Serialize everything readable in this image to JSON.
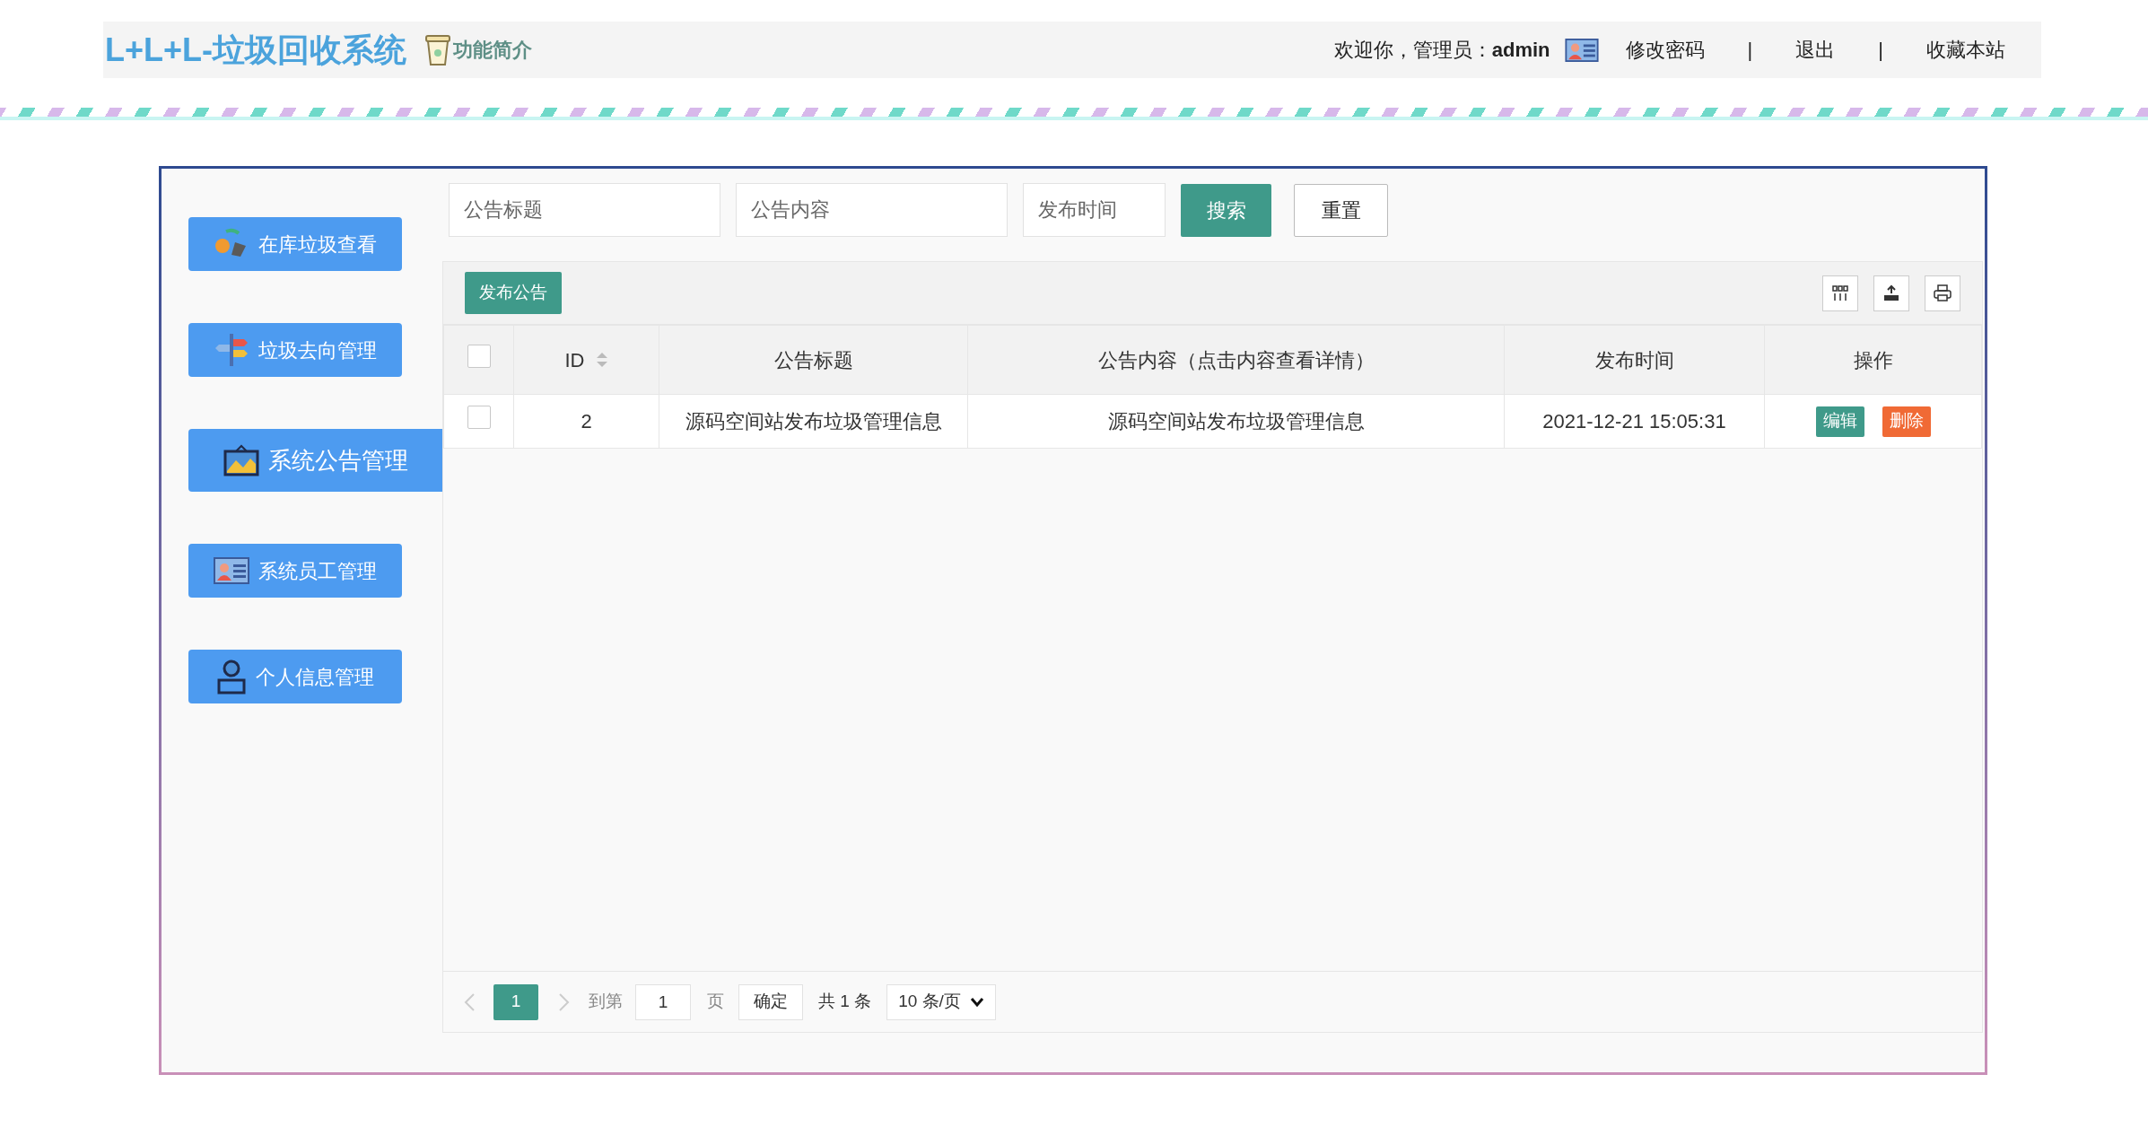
{
  "header": {
    "title": "L+L+L-垃圾回收系统",
    "intro_link": "功能简介",
    "welcome": "欢迎你，管理员：",
    "username": "admin",
    "links": [
      {
        "label": "修改密码"
      },
      {
        "label": "|",
        "kind": "separator"
      },
      {
        "label": "退出"
      },
      {
        "label": "|",
        "kind": "separator"
      },
      {
        "label": "收藏本站"
      }
    ]
  },
  "sidebar": {
    "items": [
      {
        "label": "在库垃圾查看",
        "kind": "recycle",
        "selected": false
      },
      {
        "label": "垃圾去向管理",
        "kind": "signpost",
        "selected": false
      },
      {
        "label": "系统公告管理",
        "kind": "picture",
        "selected": true
      },
      {
        "label": "系统员工管理",
        "kind": "idcard",
        "selected": false
      },
      {
        "label": "个人信息管理",
        "kind": "person",
        "selected": false
      }
    ]
  },
  "search": {
    "fields": [
      {
        "placeholder": "公告标题"
      },
      {
        "placeholder": "公告内容"
      },
      {
        "placeholder": "发布时间"
      }
    ],
    "search_button": "搜索",
    "reset_button": "重置"
  },
  "toolbar": {
    "publish_button": "发布公告"
  },
  "table": {
    "columns": [
      {
        "label": "ID",
        "sortable": true
      },
      {
        "label": "公告标题",
        "sortable": false
      },
      {
        "label": "公告内容（点击内容查看详情）",
        "sortable": false
      },
      {
        "label": "发布时间",
        "sortable": false
      },
      {
        "label": "操作",
        "sortable": false
      }
    ],
    "rows": [
      {
        "checked": false,
        "cells": [
          "2",
          "源码空间站发布垃圾管理信息",
          "源码空间站发布垃圾管理信息",
          "2021-12-21 15:05:31"
        ],
        "actions": [
          {
            "label": "编辑",
            "kind": "edit"
          },
          {
            "label": "删除",
            "kind": "delete"
          }
        ]
      }
    ],
    "header_checked": false
  },
  "pagination": {
    "pages": [
      {
        "label": "1",
        "selected": true
      }
    ],
    "goto_label": "到第",
    "goto_value": "1",
    "page_unit": "页",
    "confirm_button": "确定",
    "total": "共 1 条",
    "page_size": "10 条/页"
  }
}
